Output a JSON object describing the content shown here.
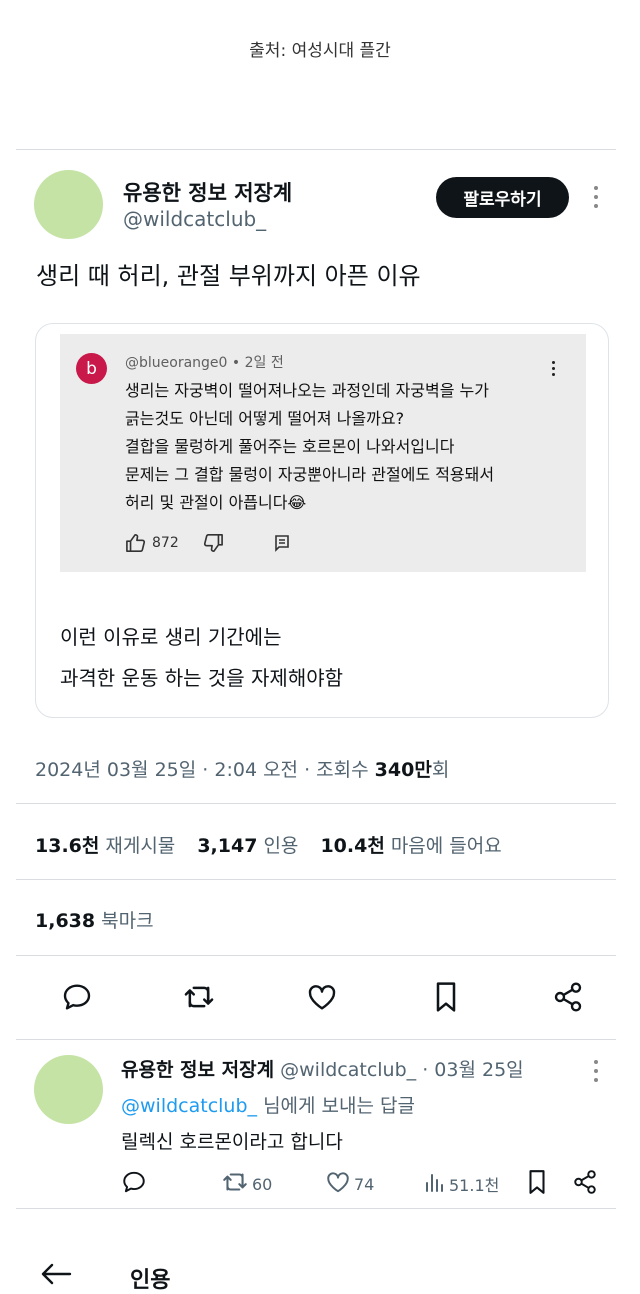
{
  "source_caption": "출처: 여성시대 플간",
  "author": {
    "name": "유용한 정보 저장계",
    "handle": "@wildcatclub_"
  },
  "follow_label": "팔로우하기",
  "tweet_text": "생리 때 허리, 관절 부위까지 아픈 이유",
  "quoted_comment": {
    "avatar_letter": "b",
    "handle": "@blueorange0",
    "time": "2일 전",
    "lines": [
      "생리는 자궁벽이 떨어져나오는 과정인데 자궁벽을 누가",
      "긁는것도 아닌데 어떻게 떨어져 나올까요?",
      "결합을 물렁하게 풀어주는 호르몬이 나와서입니다",
      "문제는 그 결합 물렁이 자궁뿐아니라 관절에도 적용돼서",
      "허리 및 관절이 아픕니다😂"
    ],
    "likes": "872"
  },
  "card_text": [
    "이런 이유로 생리 기간에는",
    "과격한 운동 하는 것을 자제해야함"
  ],
  "meta": {
    "date": "2024년 03월 25일",
    "time": "2:04 오전",
    "views_label": "조회수",
    "views_value": "340만",
    "views_unit": "회"
  },
  "stats": {
    "retweets_value": "13.6천",
    "retweets_label": "재게시물",
    "quotes_value": "3,147",
    "quotes_label": "인용",
    "likes_value": "10.4천",
    "likes_label": "마음에 들어요",
    "bookmarks_value": "1,638",
    "bookmarks_label": "북마크"
  },
  "actions": [
    "reply-icon",
    "retweet-icon",
    "heart-icon",
    "bookmark-icon",
    "share-icon"
  ],
  "reply": {
    "name": "유용한 정보 저장계",
    "handle": "@wildcatclub_",
    "date": "03월 25일",
    "to_handle": "@wildcatclub_",
    "to_suffix": "님에게 보내는 답글",
    "text": "릴렉신 호르몬이라고 합니다",
    "retweets": "60",
    "likes": "74",
    "views": "51.1천"
  },
  "bottom_title": "인용",
  "colors": {
    "accent": "#1d9bf0",
    "avatar": "#c4e3a4",
    "button_bg": "#0f1419",
    "comment_avatar": "#c9184a"
  }
}
